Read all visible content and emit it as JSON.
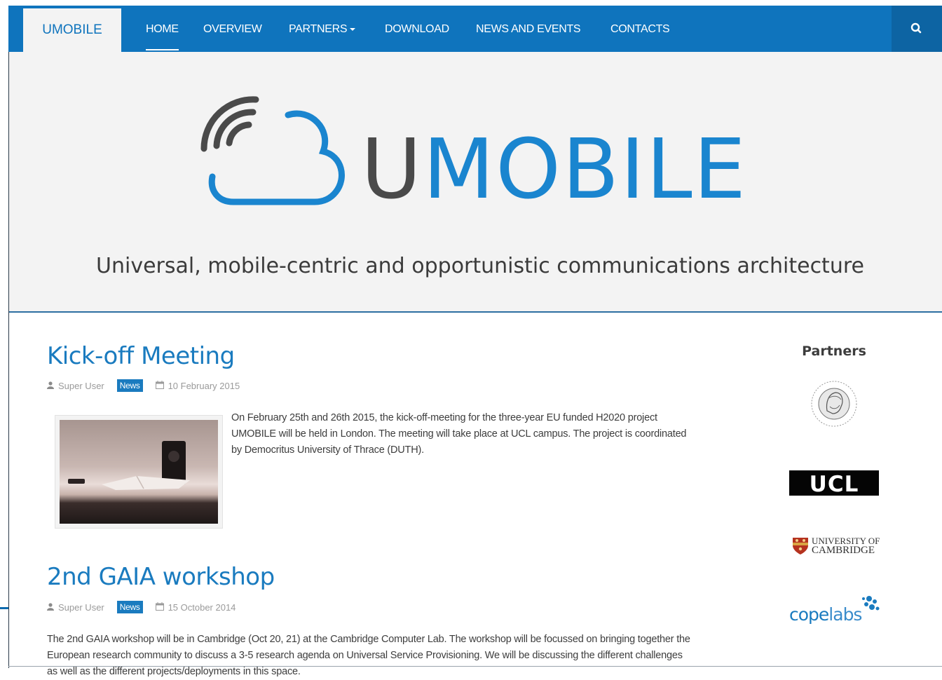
{
  "navbar": {
    "brand": "UMOBILE",
    "items": [
      {
        "label": "HOME",
        "active": true
      },
      {
        "label": "OVERVIEW"
      },
      {
        "label": "PARTNERS",
        "has_dropdown": true
      },
      {
        "label": "DOWNLOAD"
      },
      {
        "label": "NEWS AND EVENTS"
      },
      {
        "label": "CONTACTS"
      }
    ],
    "search_icon": "search-icon",
    "color": "#0f74bd"
  },
  "hero": {
    "logo_text_u": "U",
    "logo_text_rest": "MOBILE",
    "tagline": "Universal, mobile-centric and opportunistic communications architecture",
    "logo_blue": "#1a85cf",
    "logo_gray": "#4a4a4a"
  },
  "articles": [
    {
      "title": "Kick-off Meeting",
      "author": "Super User",
      "category": "News",
      "date": "10 February 2015",
      "body": "On February 25th and 26th 2015, the kick-off-meeting for the three-year EU funded H2020 project UMOBILE will be held in London. The meeting will take place at UCL campus. The project is coordinated by Democritus University of Thrace (DUTH)."
    },
    {
      "title": "2nd GAIA workshop",
      "author": "Super User",
      "category": "News",
      "date": "15 October 2014",
      "body": "The 2nd GAIA workshop will be in Cambridge (Oct 20, 21) at the Cambridge Computer Lab. The workshop will be focussed on bringing together the European research community to discuss a 3-5 research agenda on Universal Service Provisioning. We will be discussing the different challenges as well as the different projects/deployments in this space."
    }
  ],
  "sidebar": {
    "title": "Partners",
    "partners": [
      {
        "name": "duth-seal-logo"
      },
      {
        "name": "ucl-logo",
        "text": "UCL"
      },
      {
        "name": "cambridge-logo",
        "line1": "UNIVERSITY OF",
        "line2": "CAMBRIDGE"
      },
      {
        "name": "copelabs-logo",
        "text_bold": "cope",
        "text_light": "labs"
      }
    ]
  }
}
